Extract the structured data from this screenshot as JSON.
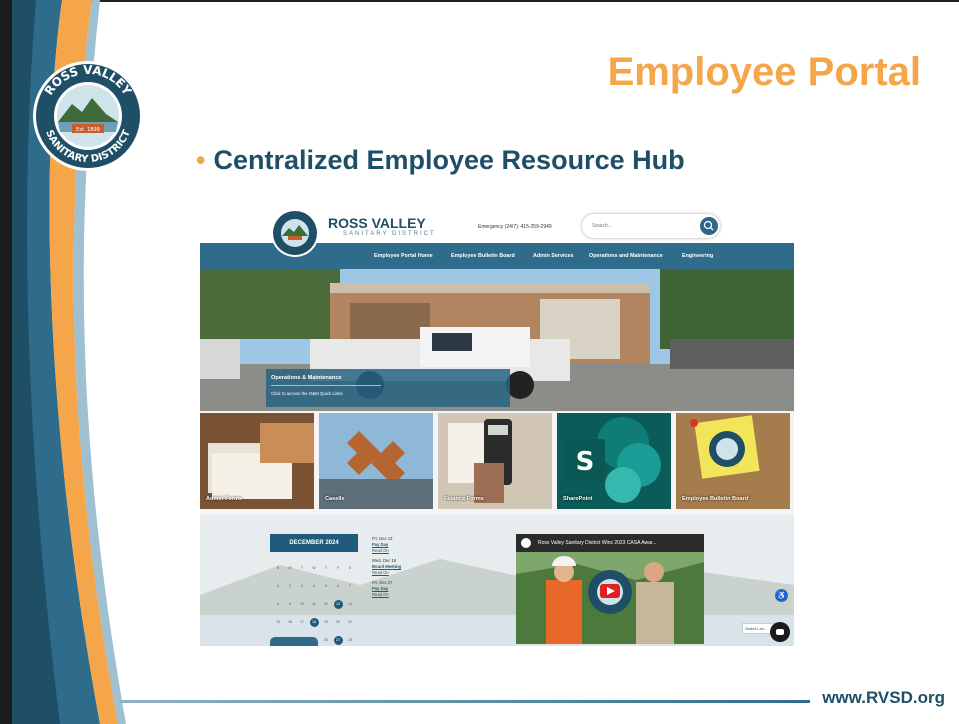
{
  "slide": {
    "title": "Employee Portal",
    "bullet": "Centralized Employee Resource Hub",
    "url": "www.RVSD.org",
    "logo": {
      "top_text": "ROSS VALLEY",
      "bottom_text": "SANITARY DISTRICT",
      "est": "Est. 1899"
    }
  },
  "site": {
    "brand": "ROSS VALLEY",
    "brand_sub": "SANITARY DISTRICT",
    "emergency": "Emergency (24/7): 415-259-2949",
    "search_placeholder": "Search...",
    "nav": [
      "Employee Portal Home",
      "Employee Bulletin Board",
      "Admin Services",
      "Operations and Maintenance",
      "Engineering"
    ],
    "hero": {
      "title": "Operations & Maintenance",
      "subtitle": "Click to access the O&M Quick Links"
    },
    "tiles": [
      "Admin Forms",
      "Caselle",
      "Finance Forms",
      "SharePoint",
      "Employee Bulletin Board"
    ],
    "calendar": {
      "month": "DECEMBER 2024",
      "weekdays": [
        "S",
        "M",
        "T",
        "W",
        "T",
        "F",
        "S"
      ],
      "weeks": [
        [
          "1",
          "2",
          "3",
          "4",
          "5",
          "6",
          "7"
        ],
        [
          "8",
          "9",
          "10",
          "11",
          "12",
          "13",
          "14"
        ],
        [
          "15",
          "16",
          "17",
          "18",
          "19",
          "20",
          "21"
        ],
        [
          "22",
          "23",
          "24",
          "25",
          "26",
          "27",
          "28"
        ],
        [
          "29",
          "30",
          "31",
          "1",
          "2",
          "3",
          "4"
        ]
      ],
      "highlighted": [
        "13",
        "18",
        "27"
      ]
    },
    "events": [
      {
        "date": "Fri, Dec 13",
        "title": "Pay Day",
        "link": "Read On"
      },
      {
        "date": "Wed, Dec 18",
        "title": "Board Meeting",
        "link": "Read On"
      },
      {
        "date": "Fri, Dec 27",
        "title": "Pay Day",
        "link": "Read On"
      }
    ],
    "video_title": "Ross Valley Sanitary District Wins 2023 CASA Awar...",
    "language": "Select Lan..."
  },
  "colors": {
    "accent_orange": "#f5a64a",
    "navy": "#1f4f67",
    "nav_blue": "#2f6c8b"
  }
}
